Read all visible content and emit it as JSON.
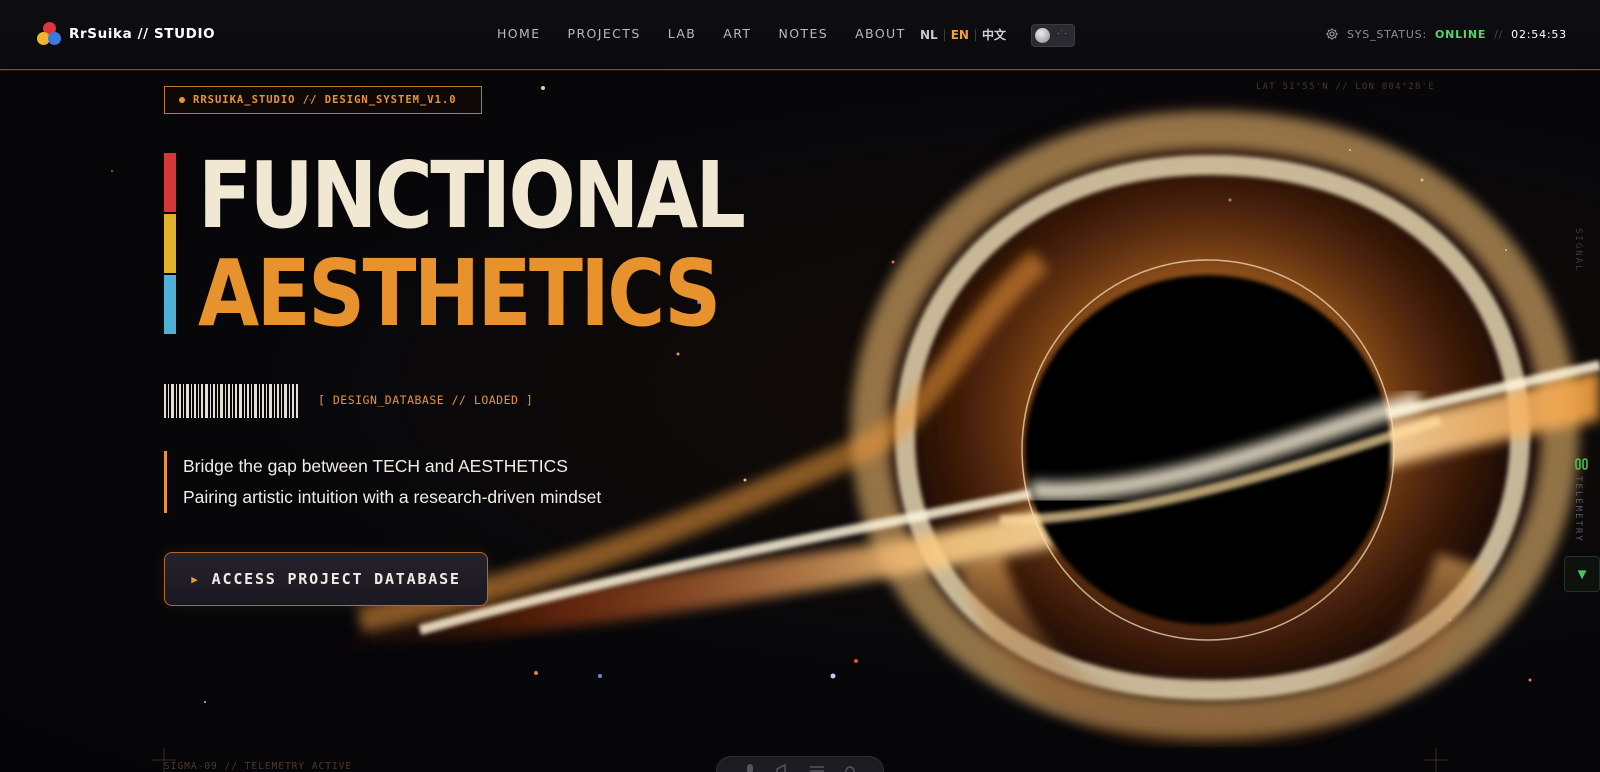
{
  "brand": {
    "name": "RrSuika // STUDIO"
  },
  "nav": {
    "items": [
      "HOME",
      "PROJECTS",
      "LAB",
      "ART",
      "NOTES",
      "ABOUT"
    ],
    "languages": [
      "NL",
      "EN",
      "中文"
    ],
    "active_language": "EN"
  },
  "status": {
    "label": "SYS_STATUS:",
    "value": "ONLINE",
    "separator": "//",
    "time": "02:54:53"
  },
  "hero": {
    "tag": "RRSUIKA_STUDIO // DESIGN_SYSTEM_V1.0",
    "title_line1": "FUNCTIONAL",
    "title_line2": "AESTHETICS",
    "db_status": "[ DESIGN_DATABASE // LOADED ]",
    "tagline1": "Bridge the gap between TECH and AESTHETICS",
    "tagline2": "Pairing artistic intuition with a research-driven mindset",
    "cta": "ACCESS PROJECT DATABASE",
    "coords": "LAT 51°55'N // LON 004°28'E",
    "telemetry": "SIGMA-09 // TELEMETRY ACTIVE"
  },
  "side": {
    "signal": "SIGNAL",
    "telemetry": "TELEMETRY"
  },
  "colors": {
    "accent": "#e8922e",
    "online": "#58d36a",
    "bar_red": "#d6363a",
    "bar_yellow": "#e2b02a",
    "bar_blue": "#4fb0d8",
    "title_light": "#f1e8d4"
  },
  "icons": {
    "logo": "tri-circle-logo-icon",
    "theme_toggle": "moon-stars-toggle-icon",
    "settings": "gear-icon",
    "cta_arrow": "play-triangle-icon",
    "scroll_down": "triangle-down-icon",
    "dock": [
      "microphone-icon",
      "megaphone-icon",
      "list-icon",
      "settings-icon"
    ]
  }
}
